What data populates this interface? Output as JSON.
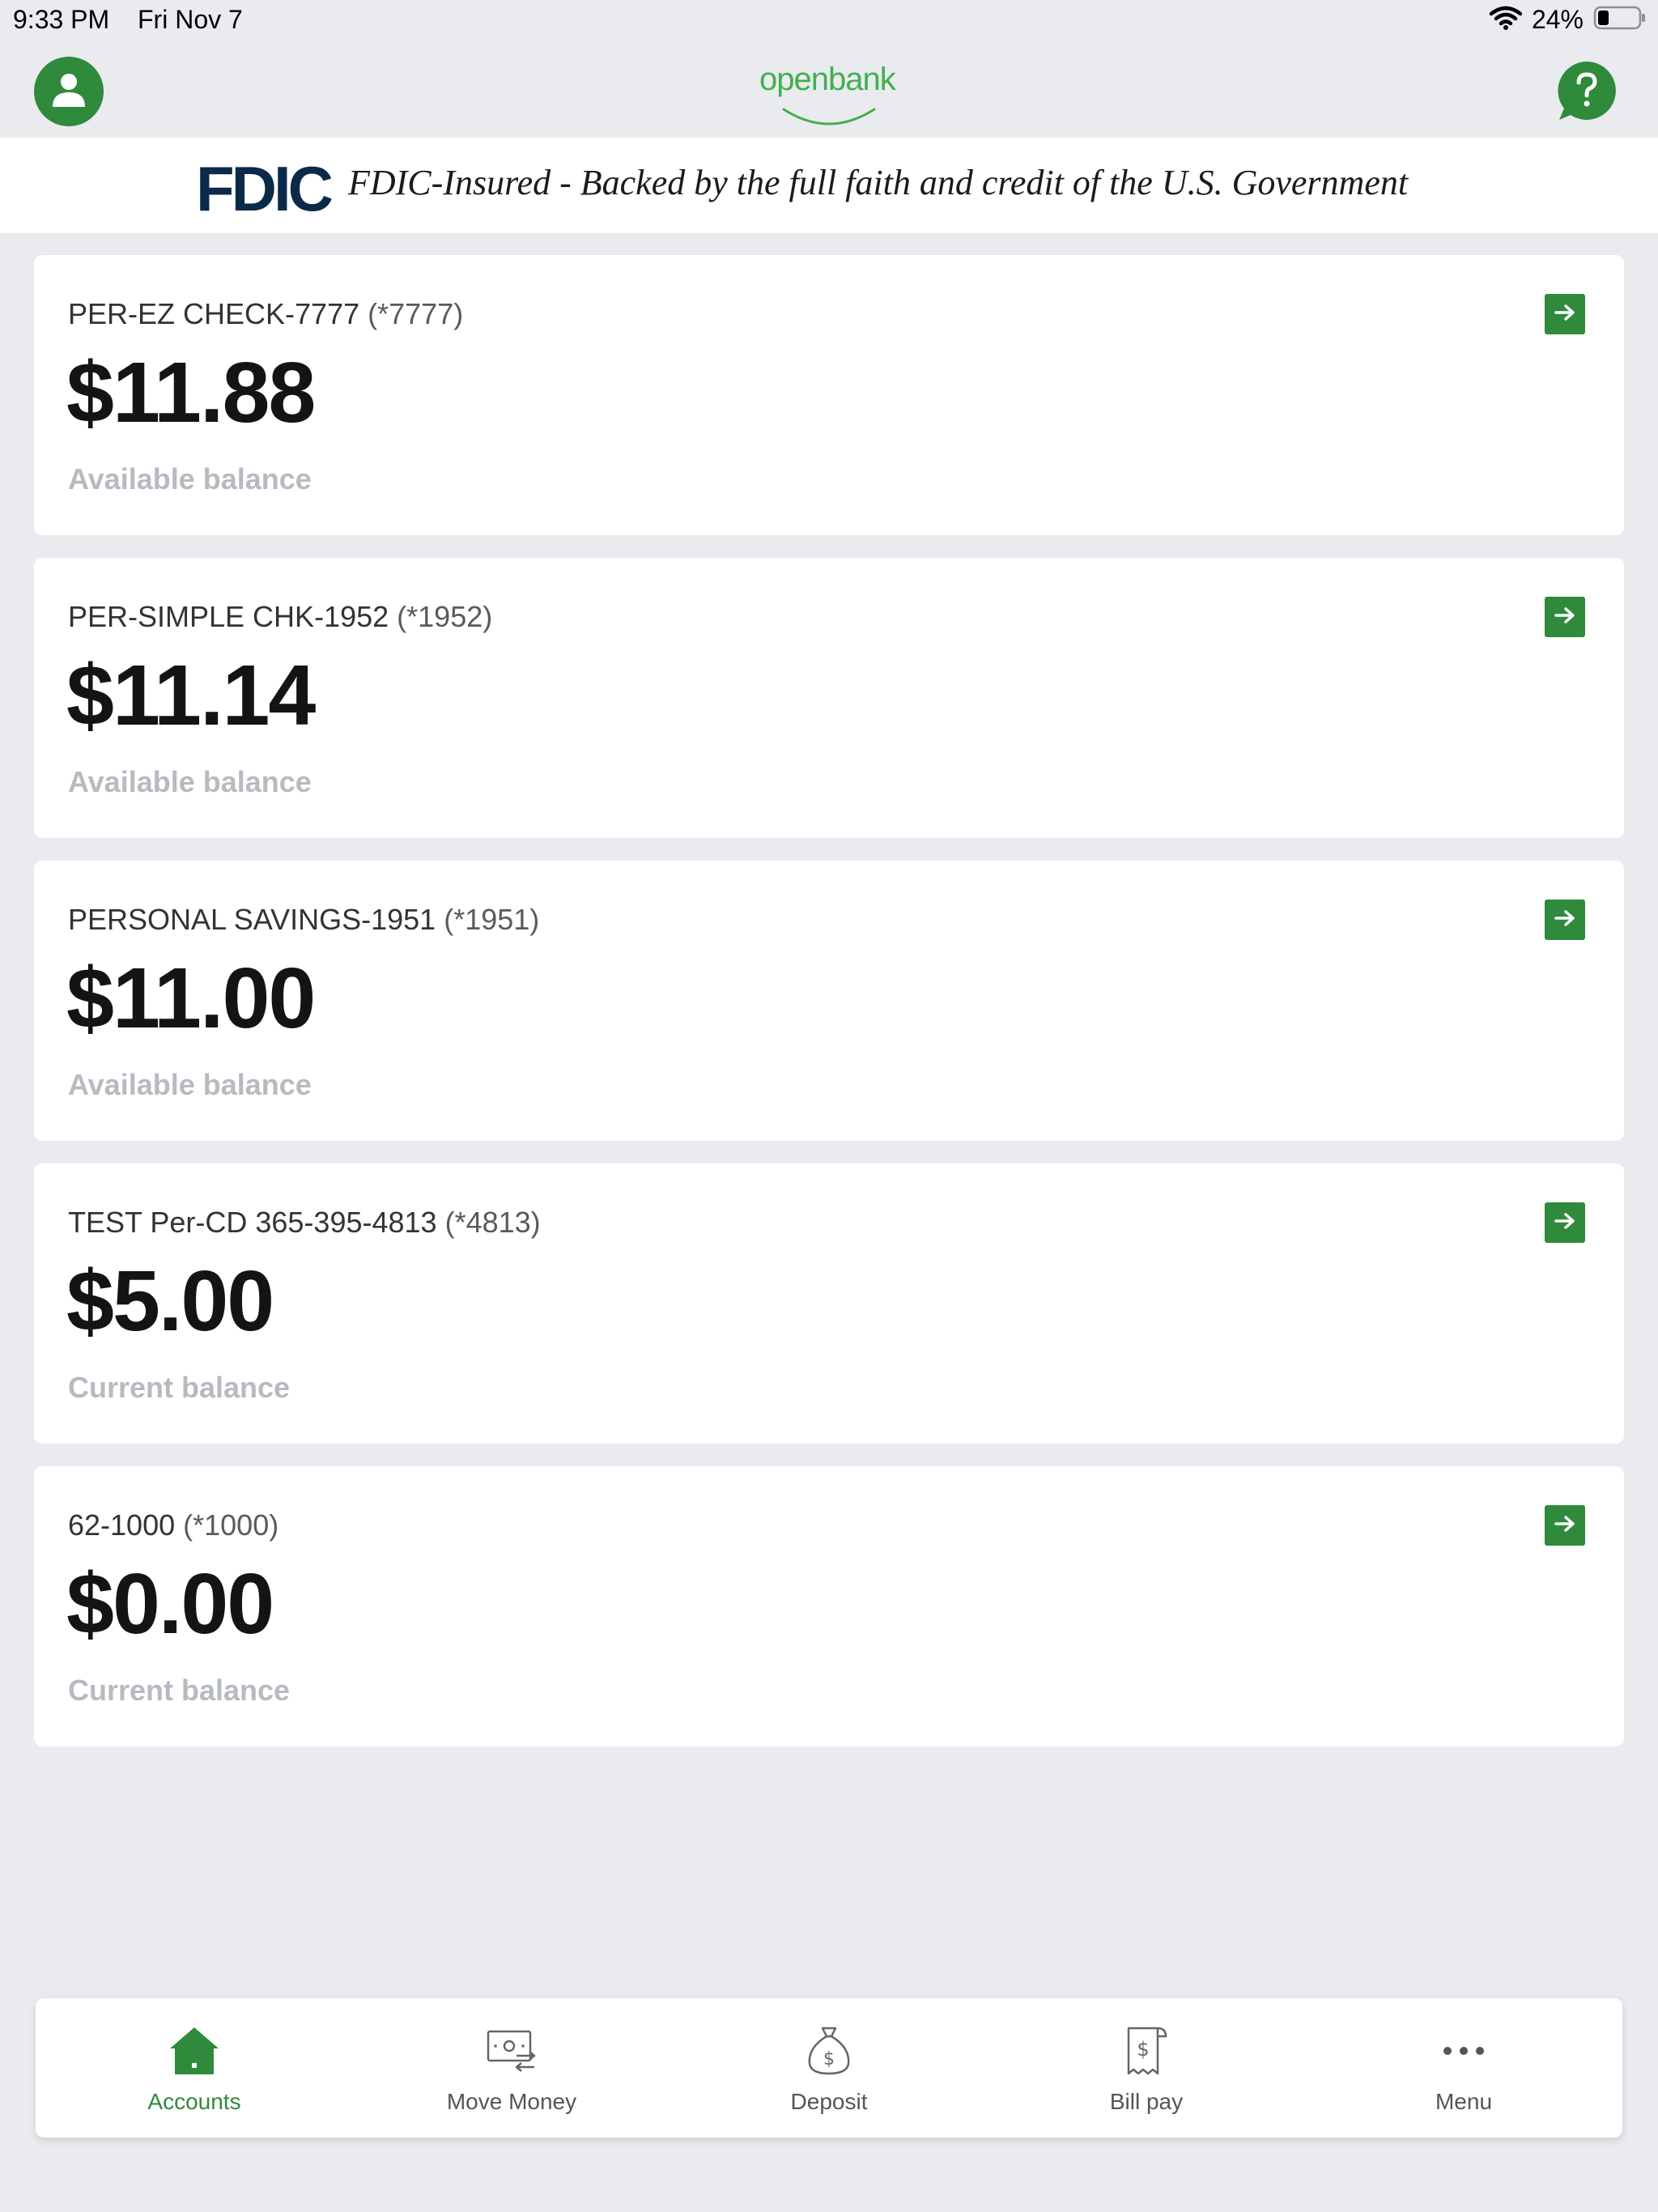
{
  "status_bar": {
    "time": "9:33 PM",
    "date": "Fri Nov 7",
    "battery_percent": "24%"
  },
  "header": {
    "logo_open": "open",
    "logo_bank": "bank"
  },
  "fdic": {
    "logo": "FDIC",
    "text": "FDIC-Insured - Backed by the full faith and credit of the U.S. Government"
  },
  "accounts": [
    {
      "name": "PER-EZ CHECK-7777",
      "mask": "(*7777)",
      "balance": "$11.88",
      "balance_label": "Available balance"
    },
    {
      "name": "PER-SIMPLE CHK-1952",
      "mask": "(*1952)",
      "balance": "$11.14",
      "balance_label": "Available balance"
    },
    {
      "name": "PERSONAL SAVINGS-1951",
      "mask": "(*1951)",
      "balance": "$11.00",
      "balance_label": "Available balance"
    },
    {
      "name": "TEST Per-CD 365-395-4813",
      "mask": "(*4813)",
      "balance": "$5.00",
      "balance_label": "Current balance"
    },
    {
      "name": "62-1000",
      "mask": "(*1000)",
      "balance": "$0.00",
      "balance_label": "Current balance"
    }
  ],
  "tabs": [
    {
      "label": "Accounts",
      "icon": "home-icon",
      "active": true
    },
    {
      "label": "Move Money",
      "icon": "transfer-icon",
      "active": false
    },
    {
      "label": "Deposit",
      "icon": "money-bag-icon",
      "active": false
    },
    {
      "label": "Bill pay",
      "icon": "receipt-icon",
      "active": false
    },
    {
      "label": "Menu",
      "icon": "more-icon",
      "active": false
    }
  ],
  "colors": {
    "brand_green": "#2f8a3c",
    "logo_green": "#42b04d",
    "fdic_navy": "#0b2a4a",
    "background": "#e9ebef",
    "muted_label": "#b6bac1"
  }
}
